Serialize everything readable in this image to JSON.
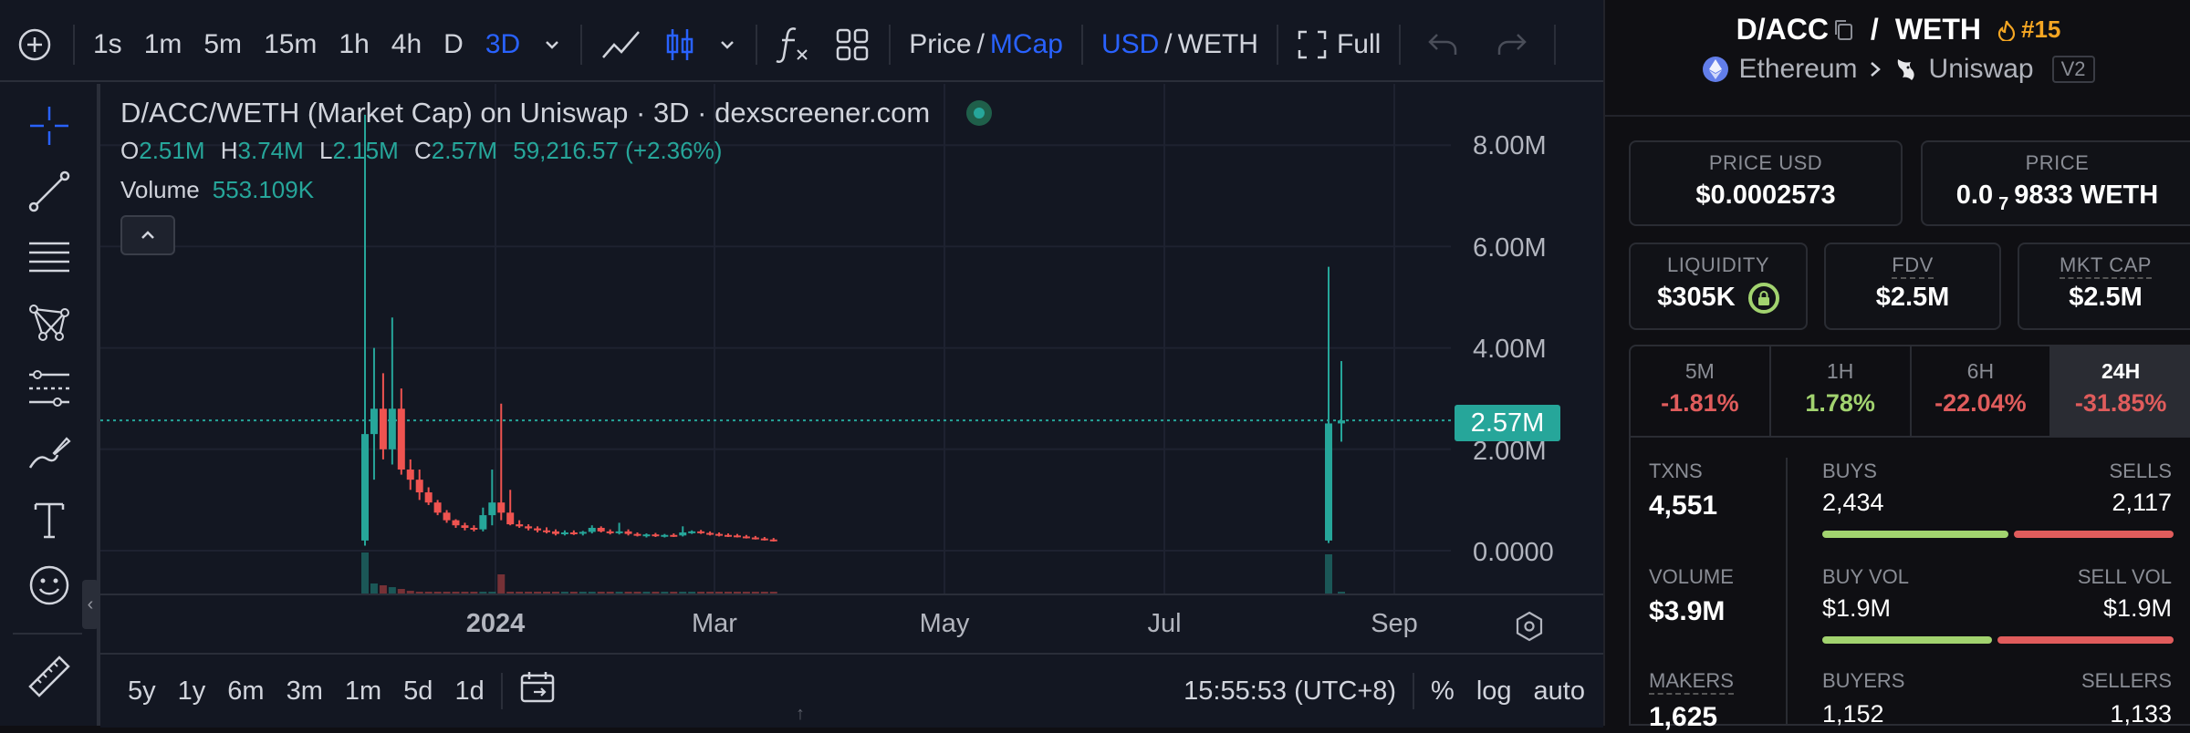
{
  "toolbar": {
    "intervals": [
      "1s",
      "1m",
      "5m",
      "15m",
      "1h",
      "4h",
      "D",
      "3D"
    ],
    "active_interval": "3D",
    "price_label": "Price",
    "slash": "/",
    "mcap_label": "MCap",
    "usd_label": "USD",
    "weth_label": "WETH",
    "full_label": "Full"
  },
  "legend": {
    "title": "D/ACC/WETH (Market Cap) on Uniswap · 3D · dexscreener.com",
    "o_label": "O",
    "o_value": "2.51M",
    "h_label": "H",
    "h_value": "3.74M",
    "l_label": "L",
    "l_value": "2.15M",
    "c_label": "C",
    "c_value": "2.57M",
    "change": "59,216.57 (+2.36%)",
    "volume_label": "Volume",
    "volume_value": "553.109K"
  },
  "y_axis": [
    "8.00M",
    "6.00M",
    "4.00M",
    "2.00M",
    "0.0000"
  ],
  "price_tag": "2.57M",
  "x_axis": [
    "2024",
    "Mar",
    "May",
    "Jul",
    "Sep"
  ],
  "bottom": {
    "ranges": [
      "5y",
      "1y",
      "6m",
      "3m",
      "1m",
      "5d",
      "1d"
    ],
    "time": "15:55:53 (UTC+8)",
    "percent": "%",
    "log": "log",
    "auto": "auto"
  },
  "colors": {
    "up": "#26a69a",
    "down": "#ef5350",
    "accent": "#2962ff",
    "buy": "#a2d36f",
    "sell": "#e05c5c"
  },
  "chart_data": {
    "type": "candlestick",
    "title": "D/ACC/WETH (Market Cap) on Uniswap · 3D · dexscreener.com",
    "ylim": [
      0,
      8500000
    ],
    "y_ticks": [
      "0.0000",
      "2.00M",
      "4.00M",
      "6.00M",
      "8.00M"
    ],
    "x_ticks": [
      "2024",
      "Mar",
      "May",
      "Jul",
      "Sep"
    ],
    "last_close": "2.57M",
    "candles": [
      {
        "o": 0.2,
        "h": 8.6,
        "l": 0.1,
        "c": 2.3
      },
      {
        "o": 2.3,
        "h": 4.0,
        "l": 1.4,
        "c": 2.8
      },
      {
        "o": 2.8,
        "h": 3.5,
        "l": 1.8,
        "c": 2.0
      },
      {
        "o": 2.0,
        "h": 4.6,
        "l": 1.7,
        "c": 2.8
      },
      {
        "o": 2.8,
        "h": 3.2,
        "l": 1.5,
        "c": 1.6
      },
      {
        "o": 1.6,
        "h": 1.8,
        "l": 1.2,
        "c": 1.4
      },
      {
        "o": 1.4,
        "h": 1.6,
        "l": 1.0,
        "c": 1.15
      },
      {
        "o": 1.15,
        "h": 1.25,
        "l": 0.9,
        "c": 0.95
      },
      {
        "o": 0.95,
        "h": 1.0,
        "l": 0.7,
        "c": 0.75
      },
      {
        "o": 0.75,
        "h": 0.8,
        "l": 0.55,
        "c": 0.6
      },
      {
        "o": 0.6,
        "h": 0.62,
        "l": 0.45,
        "c": 0.5
      },
      {
        "o": 0.5,
        "h": 0.55,
        "l": 0.4,
        "c": 0.45
      },
      {
        "o": 0.45,
        "h": 0.5,
        "l": 0.38,
        "c": 0.42
      },
      {
        "o": 0.42,
        "h": 0.85,
        "l": 0.38,
        "c": 0.7
      },
      {
        "o": 0.7,
        "h": 1.6,
        "l": 0.5,
        "c": 0.95
      },
      {
        "o": 0.95,
        "h": 2.9,
        "l": 0.6,
        "c": 0.75
      },
      {
        "o": 0.75,
        "h": 1.2,
        "l": 0.5,
        "c": 0.52
      },
      {
        "o": 0.52,
        "h": 0.6,
        "l": 0.45,
        "c": 0.48
      },
      {
        "o": 0.48,
        "h": 0.52,
        "l": 0.4,
        "c": 0.44
      },
      {
        "o": 0.44,
        "h": 0.48,
        "l": 0.36,
        "c": 0.4
      },
      {
        "o": 0.4,
        "h": 0.46,
        "l": 0.34,
        "c": 0.38
      },
      {
        "o": 0.38,
        "h": 0.42,
        "l": 0.3,
        "c": 0.33
      },
      {
        "o": 0.33,
        "h": 0.4,
        "l": 0.3,
        "c": 0.36
      },
      {
        "o": 0.36,
        "h": 0.4,
        "l": 0.31,
        "c": 0.34
      },
      {
        "o": 0.34,
        "h": 0.39,
        "l": 0.3,
        "c": 0.37
      },
      {
        "o": 0.37,
        "h": 0.5,
        "l": 0.34,
        "c": 0.45
      },
      {
        "o": 0.45,
        "h": 0.48,
        "l": 0.36,
        "c": 0.38
      },
      {
        "o": 0.38,
        "h": 0.42,
        "l": 0.32,
        "c": 0.35
      },
      {
        "o": 0.35,
        "h": 0.55,
        "l": 0.32,
        "c": 0.38
      },
      {
        "o": 0.38,
        "h": 0.42,
        "l": 0.3,
        "c": 0.33
      },
      {
        "o": 0.33,
        "h": 0.36,
        "l": 0.28,
        "c": 0.3
      },
      {
        "o": 0.3,
        "h": 0.34,
        "l": 0.26,
        "c": 0.32
      },
      {
        "o": 0.32,
        "h": 0.35,
        "l": 0.27,
        "c": 0.29
      },
      {
        "o": 0.29,
        "h": 0.33,
        "l": 0.26,
        "c": 0.31
      },
      {
        "o": 0.31,
        "h": 0.34,
        "l": 0.27,
        "c": 0.3
      },
      {
        "o": 0.3,
        "h": 0.48,
        "l": 0.28,
        "c": 0.36
      },
      {
        "o": 0.36,
        "h": 0.4,
        "l": 0.33,
        "c": 0.38
      },
      {
        "o": 0.38,
        "h": 0.41,
        "l": 0.33,
        "c": 0.35
      },
      {
        "o": 0.35,
        "h": 0.38,
        "l": 0.3,
        "c": 0.33
      },
      {
        "o": 0.33,
        "h": 0.36,
        "l": 0.28,
        "c": 0.31
      },
      {
        "o": 0.31,
        "h": 0.34,
        "l": 0.27,
        "c": 0.3
      },
      {
        "o": 0.3,
        "h": 0.33,
        "l": 0.26,
        "c": 0.28
      },
      {
        "o": 0.28,
        "h": 0.31,
        "l": 0.24,
        "c": 0.26
      },
      {
        "o": 0.26,
        "h": 0.29,
        "l": 0.22,
        "c": 0.24
      },
      {
        "o": 0.24,
        "h": 0.27,
        "l": 0.2,
        "c": 0.22
      },
      {
        "o": 0.22,
        "h": 0.25,
        "l": 0.18,
        "c": 0.2
      },
      {
        "o": 0.2,
        "h": 5.6,
        "l": 0.15,
        "c": 2.51
      },
      {
        "o": 2.51,
        "h": 3.74,
        "l": 2.15,
        "c": 2.57
      }
    ]
  },
  "pair": {
    "base": "D/ACC",
    "slash": "/",
    "quote": "WETH",
    "boost": "#15",
    "chain": "Ethereum",
    "dex": "Uniswap",
    "version": "V2"
  },
  "cards": {
    "price_usd_label": "PRICE USD",
    "price_usd": "$0.0002573",
    "price_label": "PRICE",
    "price_main": "0.0",
    "price_sub": "7",
    "price_tail": "9833 WETH",
    "liquidity_label": "LIQUIDITY",
    "liquidity": "$305K",
    "fdv_label": "FDV",
    "fdv": "$2.5M",
    "mktcap_label": "MKT CAP",
    "mktcap": "$2.5M"
  },
  "timeframes": [
    {
      "label": "5M",
      "value": "-1.81%",
      "color": "#e05c5c"
    },
    {
      "label": "1H",
      "value": "1.78%",
      "color": "#a2d36f"
    },
    {
      "label": "6H",
      "value": "-22.04%",
      "color": "#e05c5c"
    },
    {
      "label": "24H",
      "value": "-31.85%",
      "color": "#e05c5c"
    }
  ],
  "stats": {
    "txns_label": "TXNS",
    "txns": "4,551",
    "buys_label": "BUYS",
    "buys": "2,434",
    "sells_label": "SELLS",
    "sells": "2,117",
    "volume_label": "VOLUME",
    "volume": "$3.9M",
    "buy_vol_label": "BUY VOL",
    "buy_vol": "$1.9M",
    "sell_vol_label": "SELL VOL",
    "sell_vol": "$1.9M",
    "makers_label": "MAKERS",
    "makers": "1,625",
    "buyers_label": "BUYERS",
    "buyers": "1,152",
    "sellers_label": "SELLERS",
    "sellers": "1,133"
  }
}
